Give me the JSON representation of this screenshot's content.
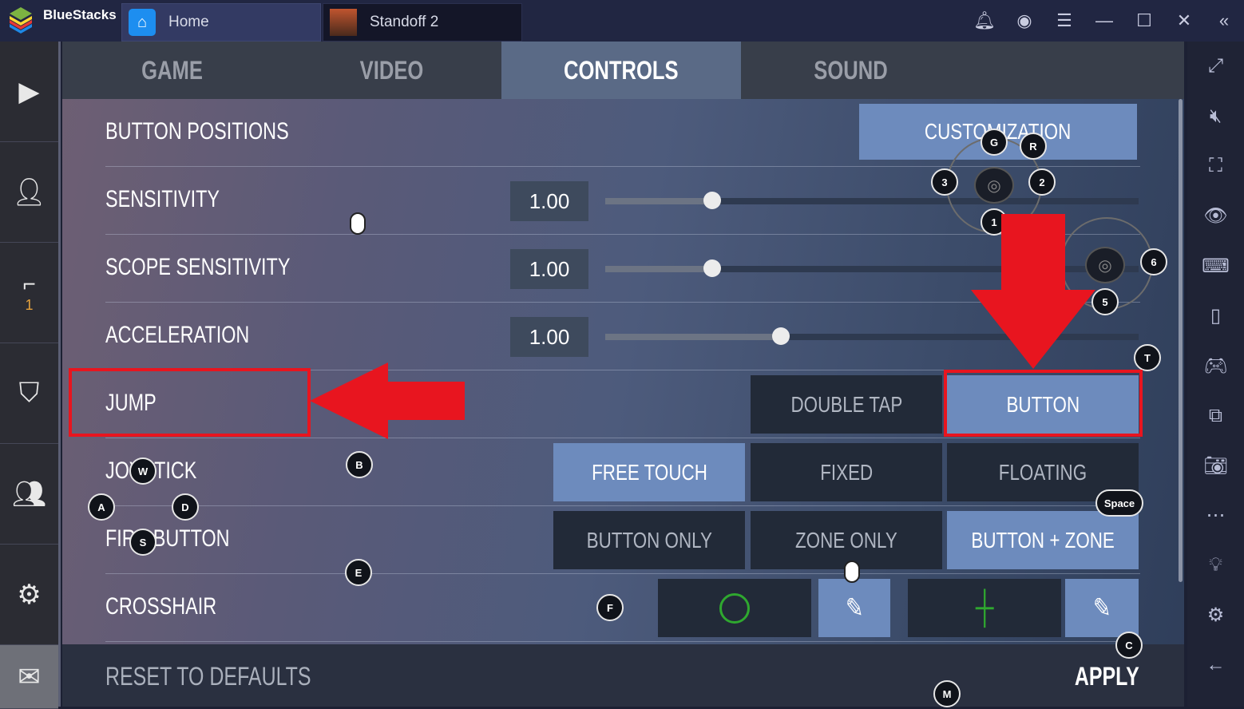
{
  "titlebar": {
    "brand": "BlueStacks",
    "tabs": [
      {
        "label": "Home"
      },
      {
        "label": "Standoff 2"
      }
    ],
    "icons": [
      "bell-icon",
      "account-icon",
      "menu-icon",
      "minimize-icon",
      "maximize-icon",
      "close-icon",
      "collapse-icon"
    ]
  },
  "left_sidebar": {
    "items": [
      {
        "icon": "play-icon"
      },
      {
        "icon": "profile-icon"
      },
      {
        "icon": "pistol-icon",
        "count": "1"
      },
      {
        "icon": "shield-icon"
      },
      {
        "icon": "friends-icon"
      },
      {
        "icon": "settings-icon"
      },
      {
        "icon": "mail-icon"
      }
    ]
  },
  "right_sidebar": {
    "icons": [
      "fullscreen-icon",
      "mute-icon",
      "screenshot-select-icon",
      "eye-icon",
      "keyboard-icon",
      "device-icon",
      "gamepad-icon",
      "media-icon",
      "camera-icon",
      "more-icon",
      "bulb-icon",
      "gear-icon",
      "back-icon"
    ]
  },
  "settings": {
    "tabs": [
      "GAME",
      "VIDEO",
      "CONTROLS",
      "SOUND"
    ],
    "active_tab": "CONTROLS",
    "rows": {
      "button_positions": {
        "label": "BUTTON POSITIONS",
        "button": "CUSTOMIZATION"
      },
      "sensitivity": {
        "label": "SENSITIVITY",
        "value": "1.00",
        "slider_fraction": 0.2
      },
      "scope_sensitivity": {
        "label": "SCOPE SENSITIVITY",
        "value": "1.00",
        "slider_fraction": 0.2
      },
      "acceleration": {
        "label": "ACCELERATION",
        "value": "1.00",
        "slider_fraction": 0.33
      },
      "jump": {
        "label": "JUMP",
        "options": [
          "DOUBLE TAP",
          "BUTTON"
        ],
        "selected": "BUTTON"
      },
      "joystick": {
        "label": "JOYSTICK",
        "options": [
          "FREE TOUCH",
          "FIXED",
          "FLOATING"
        ],
        "selected": "FREE TOUCH"
      },
      "fire_button": {
        "label": "FIRE BUTTON",
        "options": [
          "BUTTON ONLY",
          "ZONE ONLY",
          "BUTTON + ZONE"
        ],
        "selected": "BUTTON + ZONE"
      },
      "crosshair": {
        "label": "CROSSHAIR",
        "circle_color": "#2fa82f",
        "cross_color": "#2fa82f"
      }
    },
    "reset": "RESET TO DEFAULTS",
    "apply": "APPLY"
  },
  "key_markers": [
    "G",
    "R",
    "3",
    "2",
    "1",
    "6",
    "5",
    "T",
    "B",
    "W",
    "A",
    "D",
    "S",
    "E",
    "F",
    "Space",
    "C",
    "M"
  ],
  "annotation_color": "#e8151f"
}
